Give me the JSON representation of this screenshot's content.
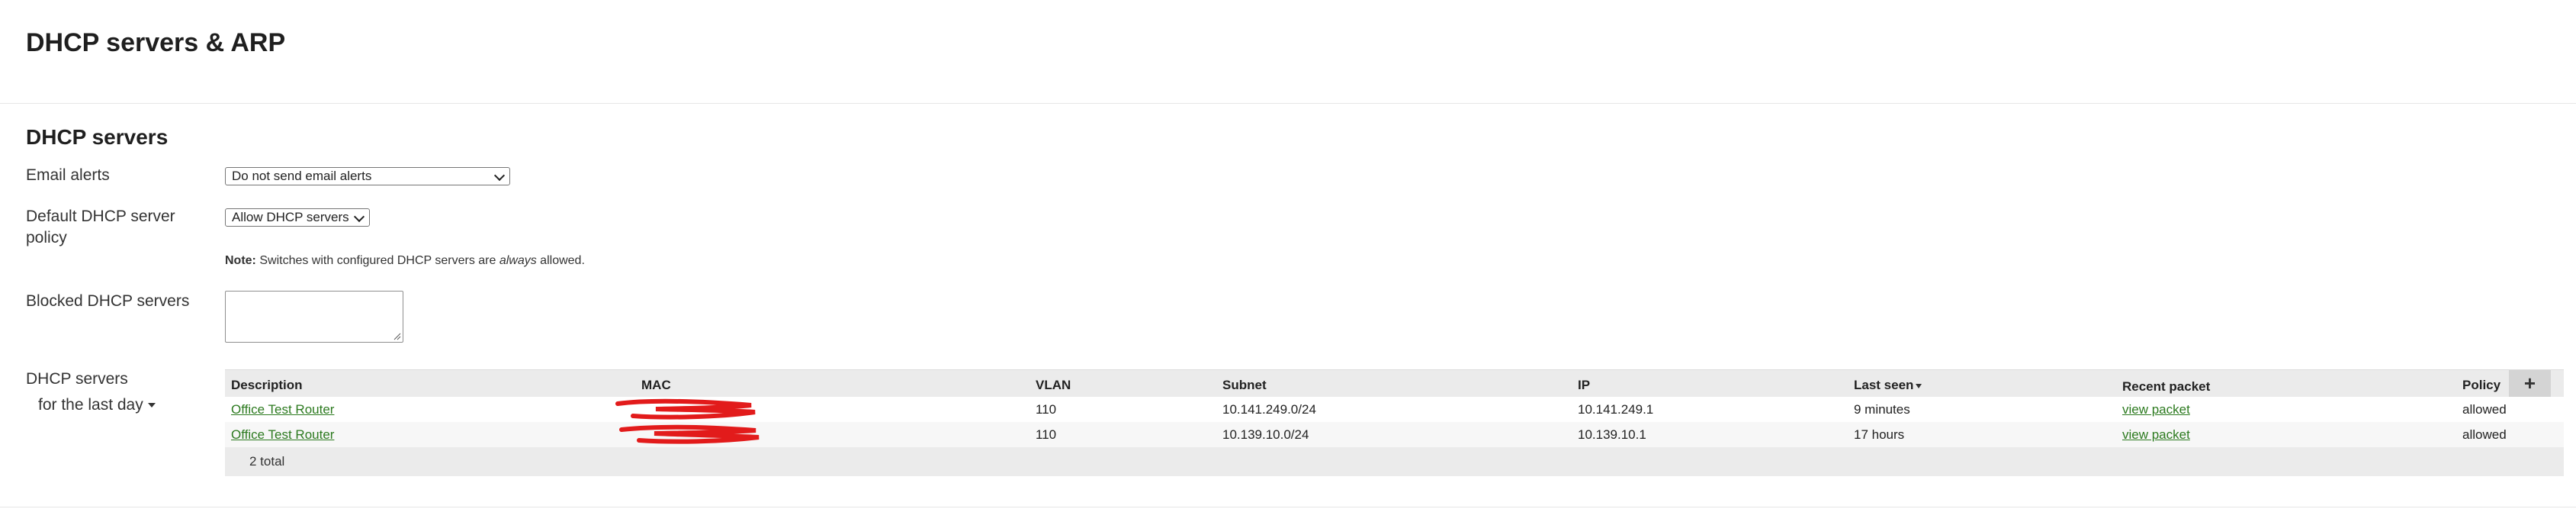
{
  "page": {
    "title": "DHCP servers & ARP"
  },
  "dhcp": {
    "section_title": "DHCP servers",
    "email_alerts": {
      "label": "Email alerts",
      "value": "Do not send email alerts"
    },
    "default_policy": {
      "label_line1": "Default DHCP server",
      "label_line2": "policy",
      "value": "Allow DHCP servers"
    },
    "note": {
      "bold": "Note:",
      "text": " Switches with configured DHCP servers are ",
      "em": "always",
      "tail": " allowed."
    },
    "blocked": {
      "label": "Blocked DHCP servers",
      "value": ""
    },
    "list": {
      "label": "DHCP servers",
      "period": "for the last day"
    },
    "table": {
      "columns": {
        "description": "Description",
        "mac": "MAC",
        "vlan": "VLAN",
        "subnet": "Subnet",
        "ip": "IP",
        "last_seen": "Last seen",
        "recent_packet": "Recent packet",
        "policy": "Policy"
      },
      "add_label": "+",
      "rows": [
        {
          "description": "Office Test Router",
          "vlan": "110",
          "subnet": "10.141.249.0/24",
          "ip": "10.141.249.1",
          "last_seen": "9 minutes",
          "recent_packet": "view packet",
          "policy": "allowed"
        },
        {
          "description": "Office Test Router",
          "vlan": "110",
          "subnet": "10.139.10.0/24",
          "ip": "10.139.10.1",
          "last_seen": "17 hours",
          "recent_packet": "view packet",
          "policy": "allowed"
        }
      ],
      "total": "2 total"
    }
  },
  "colors": {
    "link": "#2c7a1f",
    "redaction": "#e21b1b",
    "header_bg": "#ebebeb"
  }
}
